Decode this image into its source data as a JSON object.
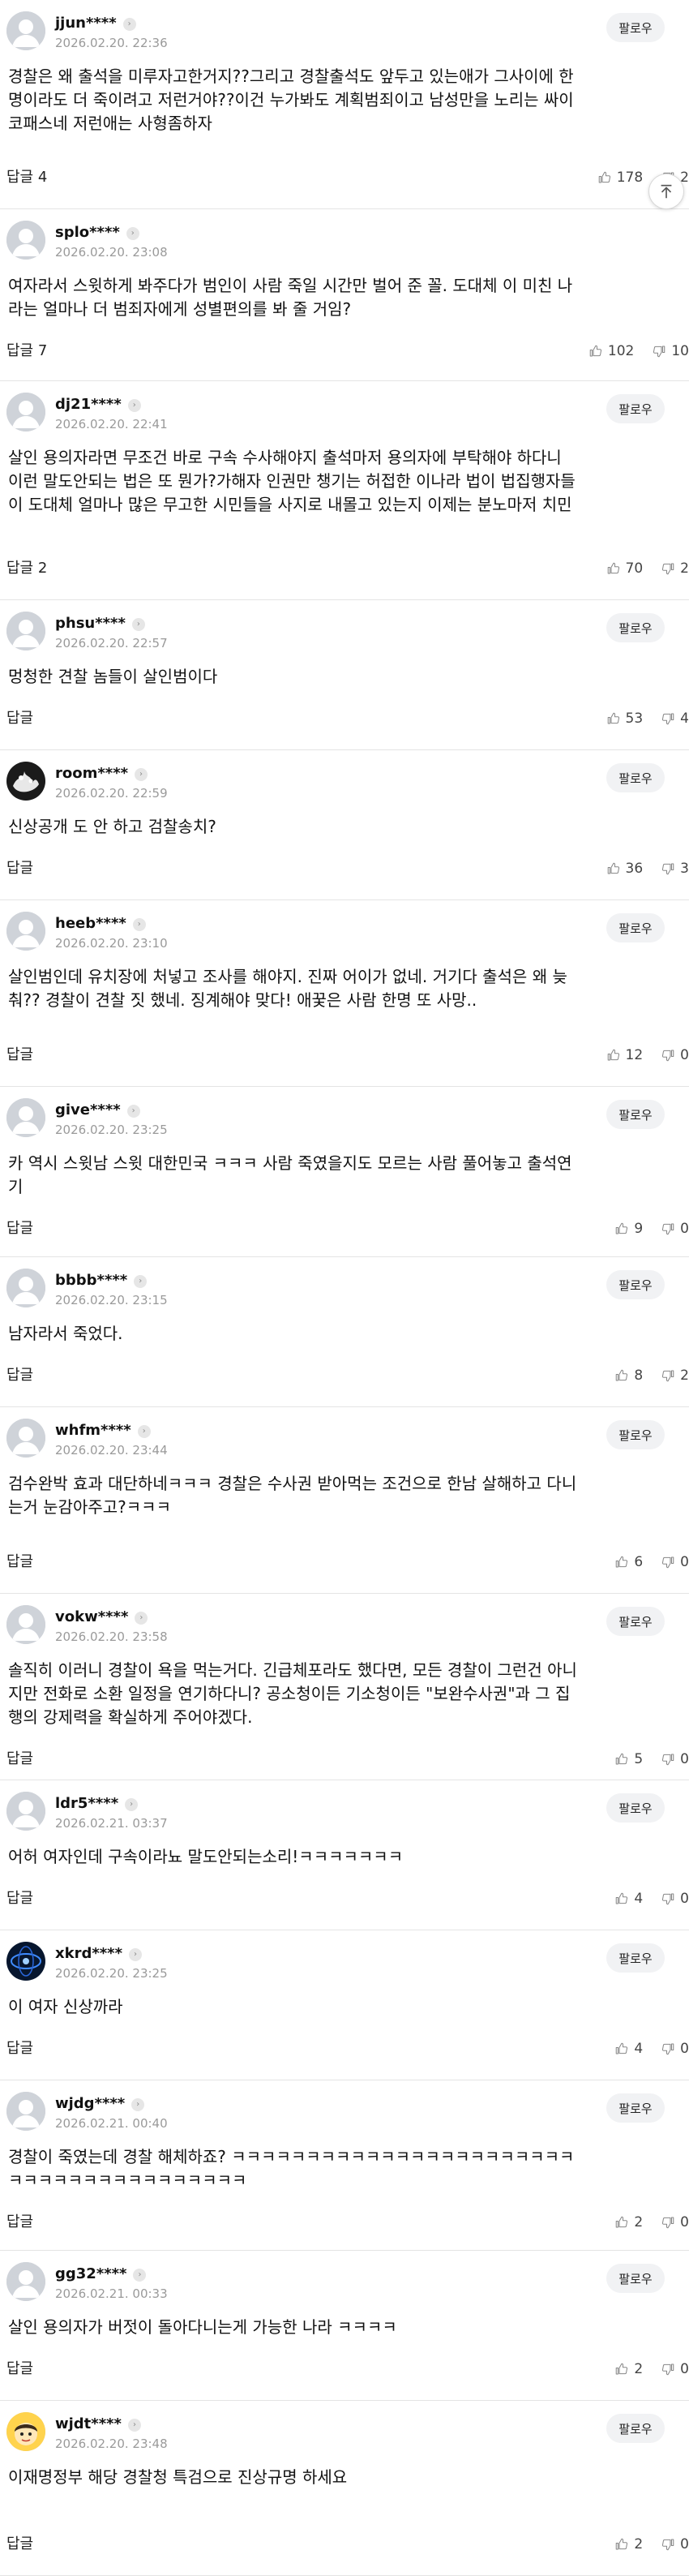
{
  "labels": {
    "follow": "팔로우",
    "reply_label": "답글"
  },
  "icons": {
    "like": "thumbs-up-icon",
    "dislike": "thumbs-down-icon",
    "scroll_top": "scroll-to-top-icon",
    "profile_menu": "chevron-right-icon"
  },
  "colors": {
    "avatar_default": "#cfd3d9",
    "follow_bg": "#f1f2f4",
    "date_text": "#9a9a9a"
  },
  "comments": [
    {
      "nick": "jjun****",
      "date": "2026.02.20. 22:36",
      "avatar": "default",
      "show_follow": true,
      "text": "경찰은 왜 출석을 미루자고한거지??그리고 경찰출석도 앞두고 있는애가 그사이에 한\n명이라도 더 죽이려고 저런거야??이건 누가봐도 계획범죄이고 남성만을 노리는 싸이\n코패스네 저런애는 사형좀하자",
      "reply": "답글 4",
      "likes": "178",
      "dislikes": "2"
    },
    {
      "nick": "splo****",
      "date": "2026.02.20. 23:08",
      "avatar": "default",
      "show_follow": false,
      "text": "여자라서 스윗하게 봐주다가 범인이 사람 죽일 시간만 벌어 준 꼴. 도대체 이 미친 나\n라는 얼마나 더 범죄자에게 성별편의를 봐 줄 거임?",
      "reply": "답글 7",
      "likes": "102",
      "dislikes": "10"
    },
    {
      "nick": "dj21****",
      "date": "2026.02.20. 22:41",
      "avatar": "default",
      "show_follow": true,
      "text": "살인 용의자라면 무조건 바로 구속 수사해야지 출석마저 용의자에 부탁해야 하다니\n이런 말도안되는 법은 또 뭔가?가해자 인권만 챙기는 허접한 이나라 법이 법집행자들\n이 도대체 얼마나 많은 무고한 시민들을 사지로 내몰고 있는지 이제는 분노마저 치민",
      "reply": "답글 2",
      "likes": "70",
      "dislikes": "2"
    },
    {
      "nick": "phsu****",
      "date": "2026.02.20. 22:57",
      "avatar": "default",
      "show_follow": true,
      "text": "멍청한 견찰 놈들이 살인범이다",
      "reply": "답글",
      "likes": "53",
      "dislikes": "4"
    },
    {
      "nick": "room****",
      "date": "2026.02.20. 22:59",
      "avatar": "dark",
      "show_follow": true,
      "text": "신상공개 도 안 하고 검찰송치?",
      "reply": "답글",
      "likes": "36",
      "dislikes": "3"
    },
    {
      "nick": "heeb****",
      "date": "2026.02.20. 23:10",
      "avatar": "default",
      "show_follow": true,
      "text": "살인범인데 유치장에 처넣고 조사를 해야지. 진짜 어이가 없네. 거기다 출석은 왜 늦\n춰?? 경찰이 견찰 짓 했네. 징계해야 맞다! 애꿎은 사람 한명 또 사망..",
      "reply": "답글",
      "likes": "12",
      "dislikes": "0"
    },
    {
      "nick": "give****",
      "date": "2026.02.20. 23:25",
      "avatar": "default",
      "show_follow": true,
      "text": "카 역시 스윗남 스윗 대한민국 ㅋㅋㅋ 사람 죽였을지도 모르는 사람 풀어놓고 출석연\n기",
      "reply": "답글",
      "likes": "9",
      "dislikes": "0"
    },
    {
      "nick": "bbbb****",
      "date": "2026.02.20. 23:15",
      "avatar": "default",
      "show_follow": true,
      "text": "남자라서 죽었다.",
      "reply": "답글",
      "likes": "8",
      "dislikes": "2"
    },
    {
      "nick": "whfm****",
      "date": "2026.02.20. 23:44",
      "avatar": "default",
      "show_follow": true,
      "text": "검수완박 효과 대단하네ㅋㅋㅋ 경찰은 수사권 받아먹는 조건으로 한남 살해하고 다니\n는거 눈감아주고?ㅋㅋㅋ",
      "reply": "답글",
      "likes": "6",
      "dislikes": "0"
    },
    {
      "nick": "vokw****",
      "date": "2026.02.20. 23:58",
      "avatar": "default",
      "show_follow": true,
      "text": "솔직히 이러니 경찰이 욕을 먹는거다. 긴급체포라도 했다면, 모든 경찰이 그런건 아니\n지만 전화로 소환 일정을 연기하다니? 공소청이든 기소청이든 \"보완수사권\"과 그 집\n행의 강제력을 확실하게 주어야겠다.",
      "reply": "답글",
      "likes": "5",
      "dislikes": "0"
    },
    {
      "nick": "ldr5****",
      "date": "2026.02.21. 03:37",
      "avatar": "default",
      "show_follow": true,
      "text": "어허 여자인데 구속이라뇨 말도안되는소리!ㅋㅋㅋㅋㅋㅋㅋ",
      "reply": "답글",
      "likes": "4",
      "dislikes": "0"
    },
    {
      "nick": "xkrd****",
      "date": "2026.02.20. 23:25",
      "avatar": "blue",
      "show_follow": true,
      "text": "이 여자 신상까라",
      "reply": "답글",
      "likes": "4",
      "dislikes": "0"
    },
    {
      "nick": "wjdg****",
      "date": "2026.02.21. 00:40",
      "avatar": "default",
      "show_follow": true,
      "text": "경찰이 죽였는데 경찰 해체하죠? ㅋㅋㅋㅋㅋㅋㅋㅋㅋㅋㅋㅋㅋㅋㅋㅋㅋㅋㅋㅋㅋㅋㅋ\nㅋㅋㅋㅋㅋㅋㅋㅋㅋㅋㅋㅋㅋㅋㅋㅋ",
      "reply": "답글",
      "likes": "2",
      "dislikes": "0"
    },
    {
      "nick": "gg32****",
      "date": "2026.02.21. 00:33",
      "avatar": "default",
      "show_follow": true,
      "text": "살인 용의자가 버젓이 돌아다니는게 가능한 나라 ㅋㅋㅋㅋ",
      "reply": "답글",
      "likes": "2",
      "dislikes": "0"
    },
    {
      "nick": "wjdt****",
      "date": "2026.02.20. 23:48",
      "avatar": "character",
      "show_follow": true,
      "text": "이재명정부 해당 경찰청 특검으로 진상규명 하세요",
      "reply": "답글",
      "likes": "2",
      "dislikes": "0"
    }
  ]
}
